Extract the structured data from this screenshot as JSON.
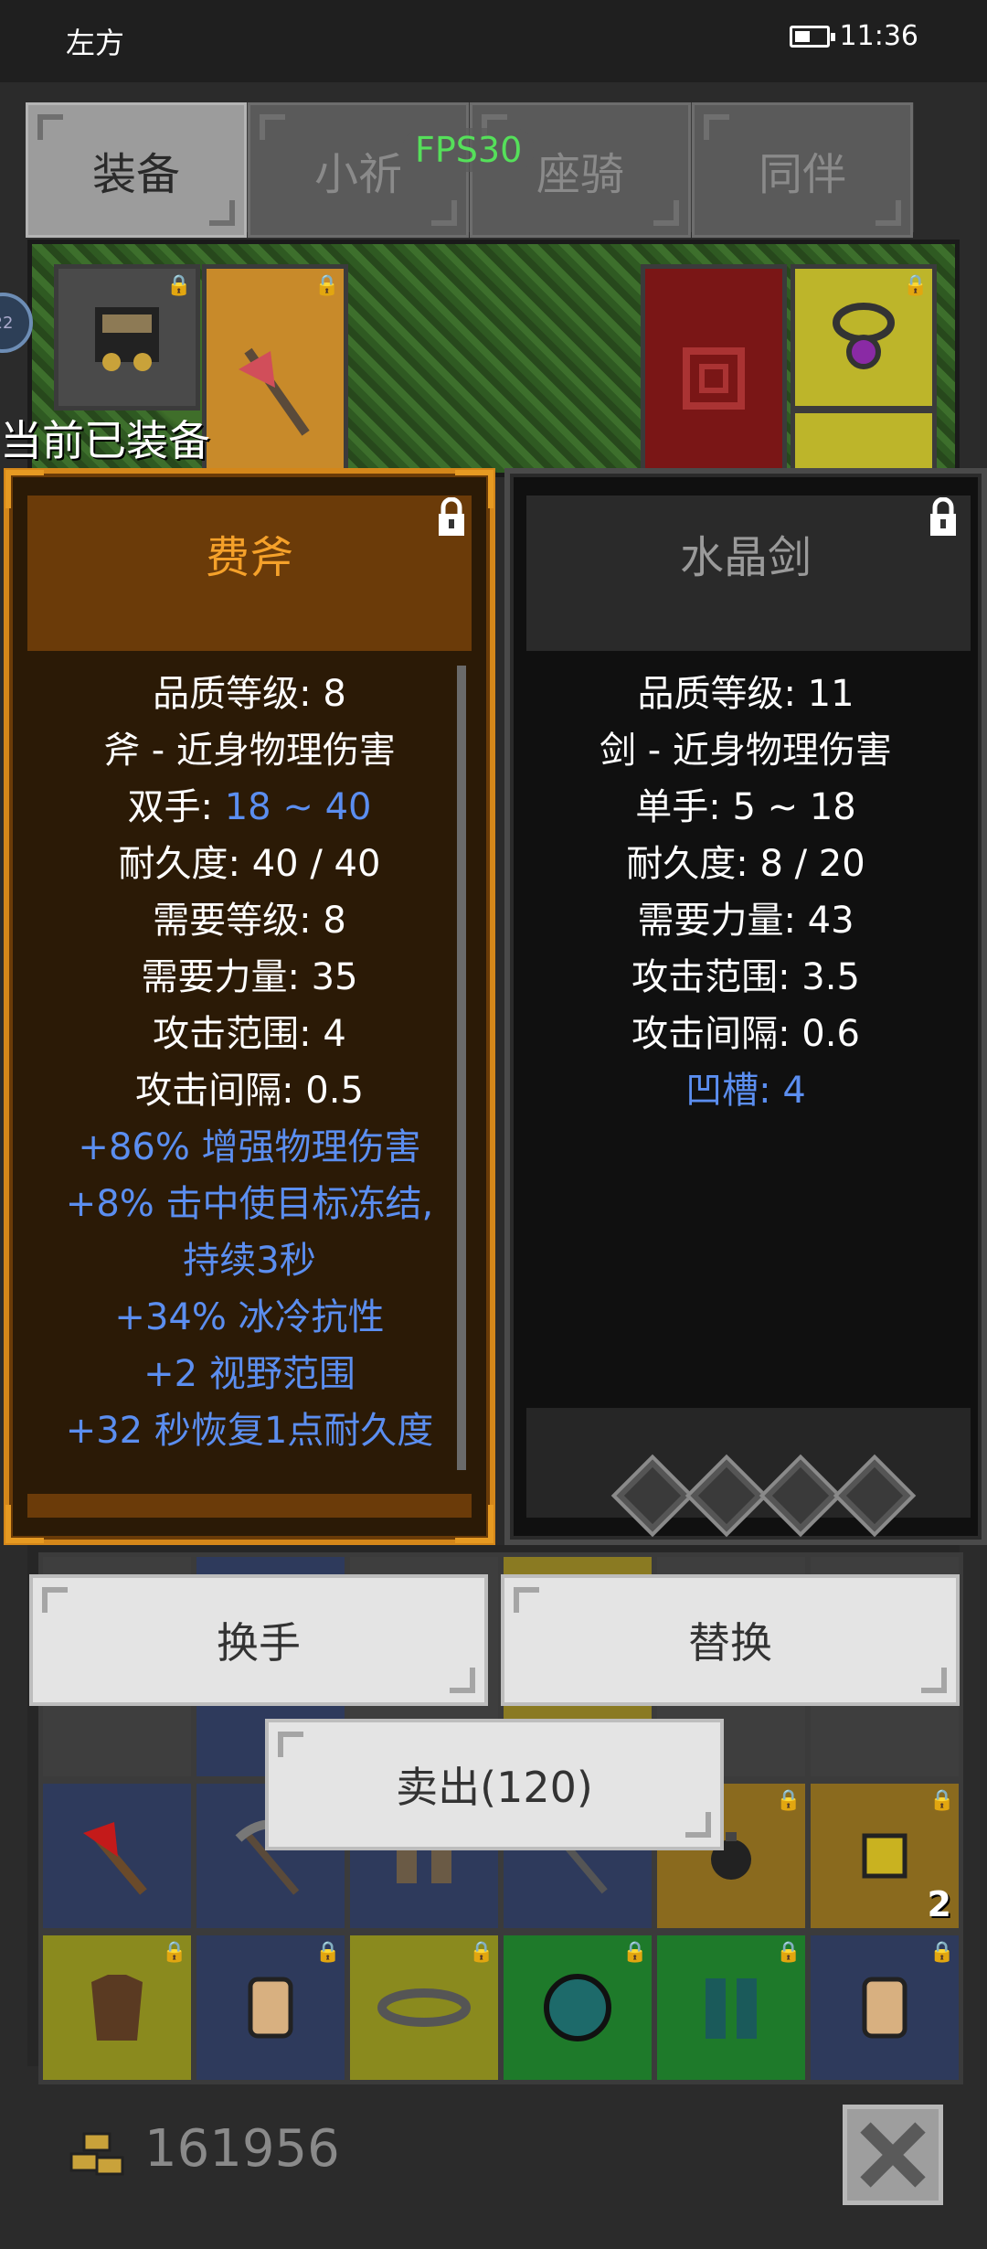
{
  "status_bar": {
    "left_text": "左方",
    "time": "11:36"
  },
  "tabs": [
    {
      "label": "装备",
      "active": true
    },
    {
      "label": "小祈",
      "active": false
    },
    {
      "label": "座骑",
      "active": false
    },
    {
      "label": "同伴",
      "active": false
    }
  ],
  "fps": "FPS30",
  "side_badge": "22",
  "equipped_label": "当前已装备",
  "left_item": {
    "name": "费斧",
    "lines": [
      {
        "text": "品质等级: 8"
      },
      {
        "text": "斧 - 近身物理伤害"
      },
      {
        "label": "双手: ",
        "value": "18 ~ 40"
      },
      {
        "text": "耐久度: 40 / 40"
      },
      {
        "text": "需要等级: 8"
      },
      {
        "text": "需要力量: 35"
      },
      {
        "text": "攻击范围: 4"
      },
      {
        "text": "攻击间隔: 0.5"
      }
    ],
    "affixes": [
      "+86% 增强物理伤害",
      "+8% 击中使目标冻结,",
      "持续3秒",
      "+34% 冰冷抗性",
      "+2 视野范围",
      "+32 秒恢复1点耐久度"
    ]
  },
  "right_item": {
    "name": "水晶剑",
    "lines": [
      "品质等级: 11",
      "剑 - 近身物理伤害",
      "单手: 5 ~ 18",
      "耐久度: 8 / 20",
      "需要力量: 43",
      "攻击范围: 3.5",
      "攻击间隔: 0.6"
    ],
    "socket_line": "凹槽: 4",
    "sockets": 4
  },
  "buttons": {
    "swap_hand": "换手",
    "replace": "替换",
    "sell": "卖出(120)"
  },
  "inventory": {
    "stack_count": "2"
  },
  "gold": "161956",
  "colors": {
    "accent_orange": "#f5a12a",
    "affix_blue": "#5b8ef0",
    "fps_green": "#55e05a"
  }
}
